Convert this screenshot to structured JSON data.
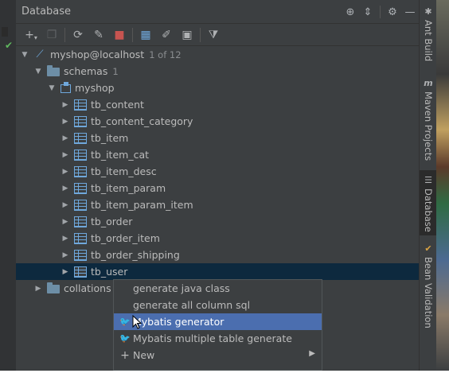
{
  "panel": {
    "title": "Database"
  },
  "toolbar": {
    "tools": [
      "add-icon",
      "copy-icon",
      "refresh-icon",
      "edit-properties-icon",
      "stop-icon",
      "table-view-icon",
      "edit-icon",
      "console-icon",
      "filter-icon"
    ]
  },
  "tree": {
    "connection": {
      "label": "myshop@localhost",
      "count": "1 of 12"
    },
    "schemas": {
      "label": "schemas",
      "count": "1"
    },
    "schema": {
      "label": "myshop"
    },
    "tables": [
      "tb_content",
      "tb_content_category",
      "tb_item",
      "tb_item_cat",
      "tb_item_desc",
      "tb_item_param",
      "tb_item_param_item",
      "tb_order",
      "tb_order_item",
      "tb_order_shipping",
      "tb_user"
    ],
    "collations": {
      "label": "collations"
    }
  },
  "right_strip": {
    "tabs": [
      "Ant Build",
      "Maven Projects",
      "Database",
      "Bean Validation"
    ]
  },
  "context_menu": {
    "items": [
      {
        "label": "generate java class"
      },
      {
        "label": "generate all column sql"
      },
      {
        "label": "Mybatis generator"
      },
      {
        "label": "Mybatis multiple table generate"
      },
      {
        "label": "New"
      }
    ]
  },
  "colors": {
    "background": "#3c3f41",
    "selection": "#0d293e",
    "menu_highlight": "#4b6eaf",
    "accent": "#6fa8dc"
  }
}
